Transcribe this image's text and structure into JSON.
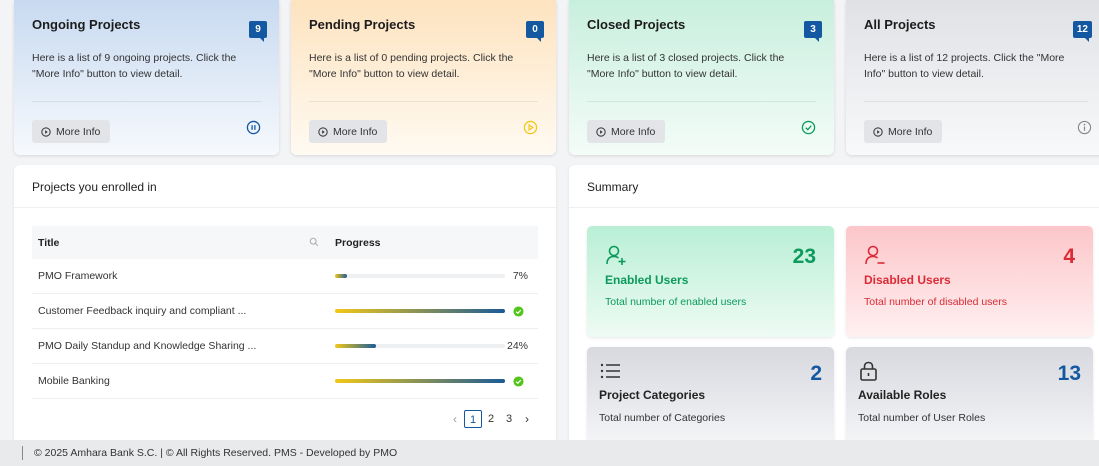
{
  "cards": {
    "ongoing": {
      "title": "Ongoing Projects",
      "count": "9",
      "desc": "Here is a list of 9 ongoing projects. Click the \"More Info\" button to view detail.",
      "button": "More Info",
      "icon": "pause-circle-icon"
    },
    "pending": {
      "title": "Pending Projects",
      "count": "0",
      "desc": "Here is a list of 0 pending projects. Click the \"More Info\" button to view detail.",
      "button": "More Info",
      "icon": "play-circle-icon"
    },
    "closed": {
      "title": "Closed Projects",
      "count": "3",
      "desc": "Here is a list of 3 closed projects. Click the \"More Info\" button to view detail.",
      "button": "More Info",
      "icon": "check-circle-icon"
    },
    "all": {
      "title": "All Projects",
      "count": "12",
      "desc": "Here is a list of 12 projects. Click the \"More Info\" button to view detail.",
      "button": "More Info",
      "icon": "info-circle-icon"
    }
  },
  "enrolled": {
    "title": "Projects you enrolled in",
    "columns": {
      "title": "Title",
      "progress": "Progress"
    },
    "rows": [
      {
        "title": "PMO Framework",
        "progress": 7,
        "label": "7%"
      },
      {
        "title": "Customer Feedback inquiry and compliant ...",
        "progress": 100,
        "label": ""
      },
      {
        "title": "PMO Daily Standup and Knowledge Sharing ...",
        "progress": 24,
        "label": "24%"
      },
      {
        "title": "Mobile Banking",
        "progress": 100,
        "label": ""
      }
    ],
    "pagination": {
      "prev": "‹",
      "pages": [
        "1",
        "2",
        "3"
      ],
      "next": "›"
    }
  },
  "summary": {
    "title": "Summary",
    "tiles": {
      "enabled": {
        "value": "23",
        "label": "Enabled Users",
        "sub": "Total number of enabled users"
      },
      "disabled": {
        "value": "4",
        "label": "Disabled Users",
        "sub": "Total number of disabled users"
      },
      "categories": {
        "value": "2",
        "label": "Project Categories",
        "sub": "Total number of Categories"
      },
      "roles": {
        "value": "13",
        "label": "Available Roles",
        "sub": "Total number of User Roles"
      }
    }
  },
  "footer": {
    "text": "© 2025 Amhara Bank S.C. | © All Rights Reserved.  PMS - Developed by PMO"
  },
  "colors": {
    "accent": "#1358a0",
    "success": "#0c9a5c",
    "danger": "#dc2a36",
    "pending": "#f2c818"
  }
}
